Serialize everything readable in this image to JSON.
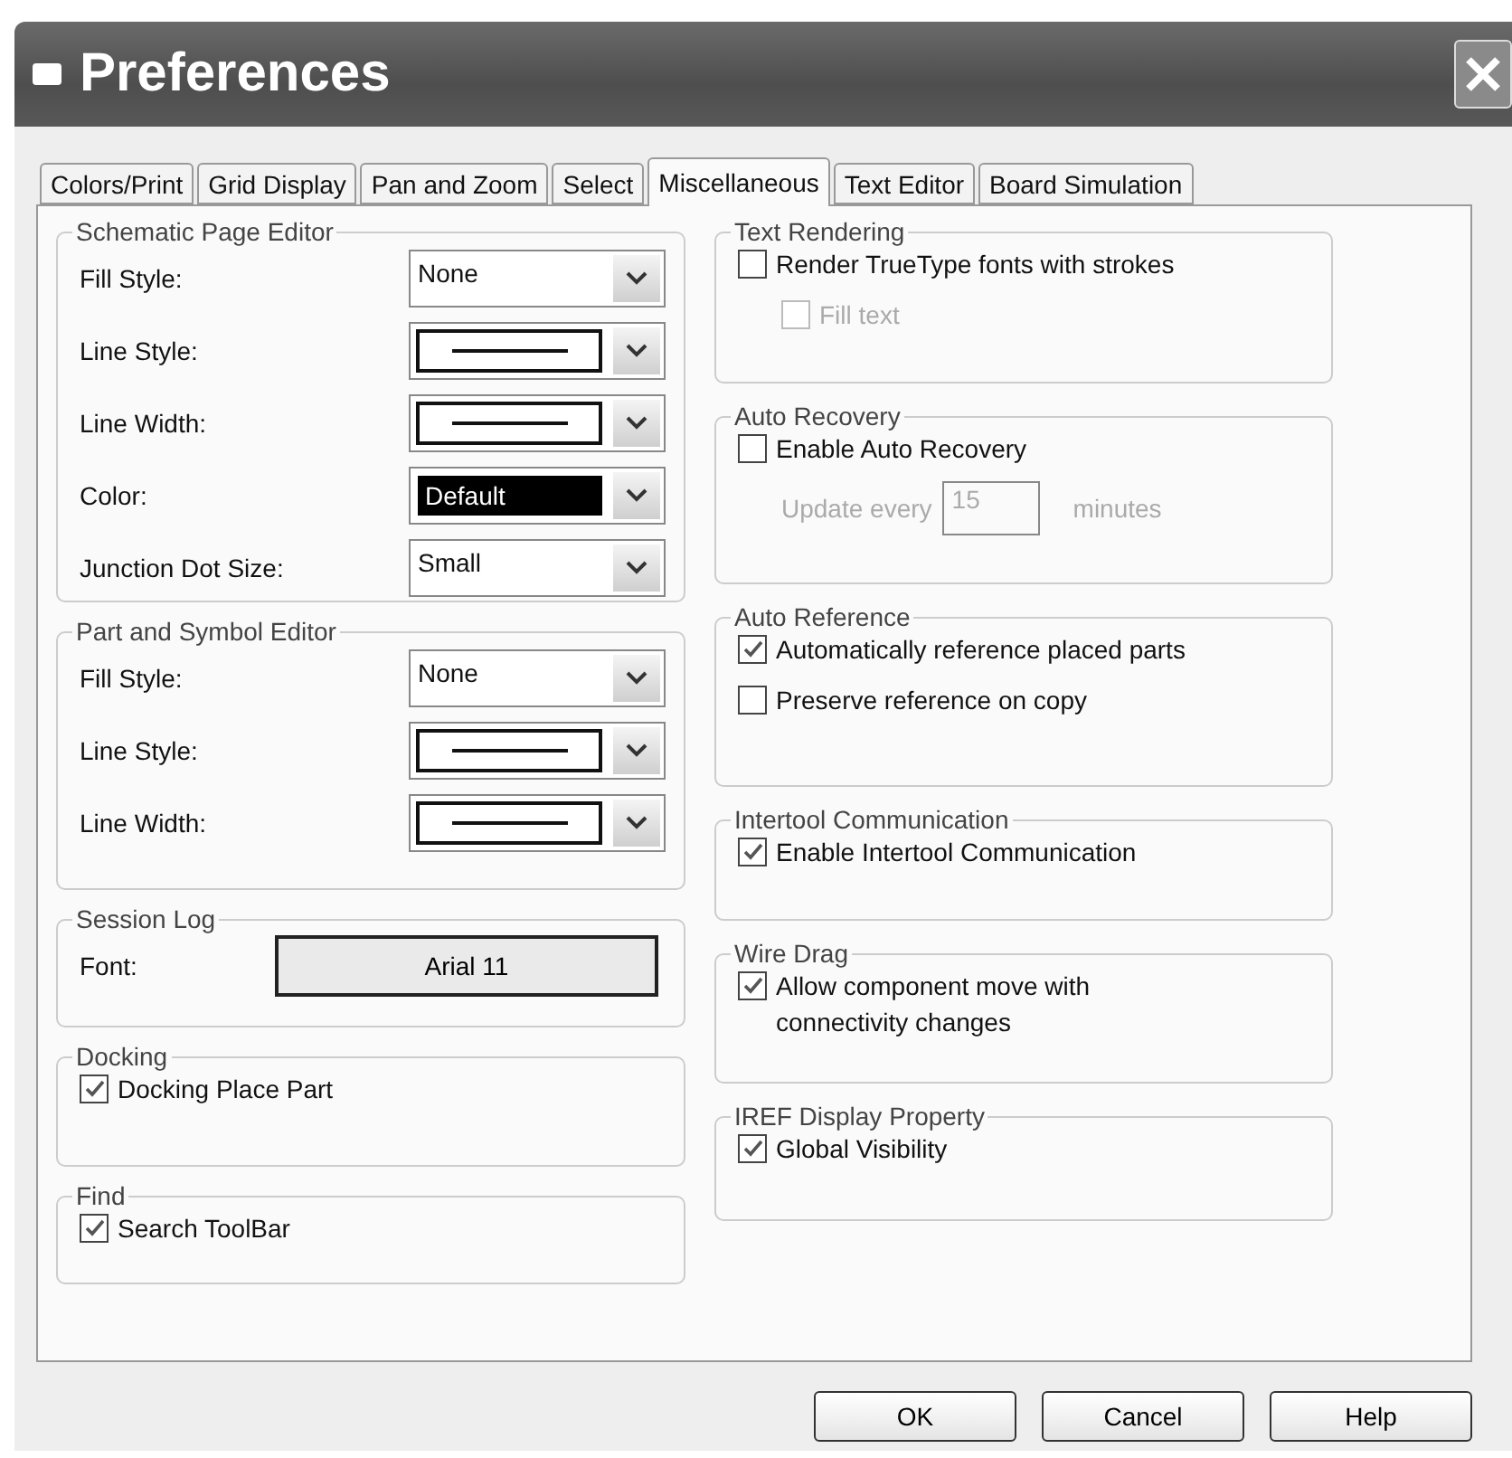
{
  "window": {
    "title": "Preferences"
  },
  "tabs": [
    {
      "label": "Colors/Print",
      "selected": false
    },
    {
      "label": "Grid Display",
      "selected": false
    },
    {
      "label": "Pan and Zoom",
      "selected": false
    },
    {
      "label": "Select",
      "selected": false
    },
    {
      "label": "Miscellaneous",
      "selected": true
    },
    {
      "label": "Text Editor",
      "selected": false
    },
    {
      "label": "Board Simulation",
      "selected": false
    }
  ],
  "left_groups": [
    {
      "title": "Schematic Page Editor",
      "items": [
        {
          "kind": "text_dropdown",
          "label": "Fill Style:",
          "value": "None"
        },
        {
          "kind": "line_dropdown",
          "label": "Line Style:"
        },
        {
          "kind": "line_dropdown",
          "label": "Line Width:"
        },
        {
          "kind": "color_dropdown",
          "label": "Color:",
          "value": "Default"
        },
        {
          "kind": "text_dropdown",
          "label": "Junction Dot Size:",
          "value": "Small"
        }
      ]
    },
    {
      "title": "Part and Symbol Editor",
      "items": [
        {
          "kind": "text_dropdown",
          "label": "Fill Style:",
          "value": "None"
        },
        {
          "kind": "line_dropdown",
          "label": "Line Style:"
        },
        {
          "kind": "line_dropdown",
          "label": "Line Width:"
        }
      ]
    },
    {
      "title": "Session Log",
      "items": [
        {
          "kind": "font",
          "label": "Font:",
          "value": "Arial 11"
        }
      ]
    },
    {
      "title": "Docking",
      "items": [
        {
          "kind": "checkbox",
          "label": "Docking Place Part",
          "checked": true,
          "disabled": false
        }
      ]
    },
    {
      "title": "Find",
      "items": [
        {
          "kind": "checkbox",
          "label": "Search ToolBar",
          "checked": true,
          "disabled": false
        }
      ]
    }
  ],
  "right_groups": [
    {
      "title": "Text Rendering",
      "items": [
        {
          "kind": "checkbox",
          "label": "Render TrueType fonts with strokes",
          "checked": false,
          "disabled": false,
          "children": [
            {
              "kind": "checkbox",
              "label": "Fill text",
              "checked": false,
              "disabled": true
            }
          ]
        }
      ]
    },
    {
      "title": "Auto Recovery",
      "items": [
        {
          "kind": "checkbox",
          "label": "Enable Auto Recovery",
          "checked": false,
          "disabled": false
        },
        {
          "kind": "interval",
          "label": "Update every",
          "value": "15",
          "unit": "minutes",
          "disabled": true
        }
      ]
    },
    {
      "title": "Auto Reference",
      "items": [
        {
          "kind": "checkbox",
          "label": "Automatically reference placed parts",
          "checked": true,
          "disabled": false
        },
        {
          "kind": "checkbox",
          "label": "Preserve reference on copy",
          "checked": false,
          "disabled": false
        }
      ]
    },
    {
      "title": "Intertool Communication",
      "items": [
        {
          "kind": "checkbox",
          "label": "Enable Intertool Communication",
          "checked": true,
          "disabled": false
        }
      ]
    },
    {
      "title": "Wire Drag",
      "items": [
        {
          "kind": "checkbox",
          "label": "Allow component move with connectivity changes",
          "checked": true,
          "disabled": false
        }
      ]
    },
    {
      "title": "IREF Display Property",
      "items": [
        {
          "kind": "checkbox",
          "label": "Global Visibility",
          "checked": true,
          "disabled": false
        }
      ]
    }
  ],
  "buttons": [
    "OK",
    "Cancel",
    "Help"
  ]
}
